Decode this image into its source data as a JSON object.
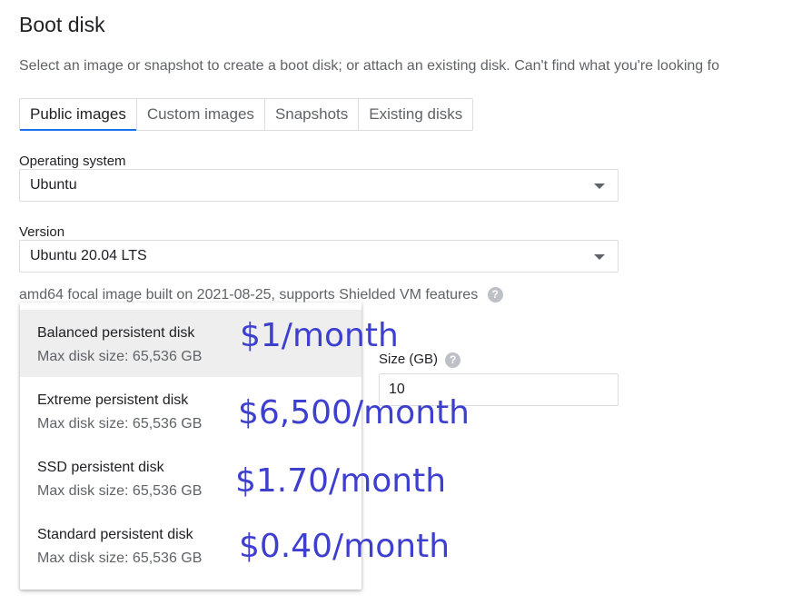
{
  "section": {
    "title": "Boot disk",
    "description": "Select an image or snapshot to create a boot disk; or attach an existing disk. Can't find what you're looking fo"
  },
  "tabs": [
    {
      "label": "Public images",
      "active": true
    },
    {
      "label": "Custom images",
      "active": false
    },
    {
      "label": "Snapshots",
      "active": false
    },
    {
      "label": "Existing disks",
      "active": false
    }
  ],
  "os": {
    "label": "Operating system",
    "value": "Ubuntu"
  },
  "version": {
    "label": "Version",
    "value": "Ubuntu 20.04 LTS",
    "helper": "amd64 focal image built on 2021-08-25, supports Shielded VM features",
    "help_icon": "help-circle-icon"
  },
  "size": {
    "label": "Size (GB)",
    "value": "10",
    "help_icon": "help-circle-icon"
  },
  "disk_type_options": [
    {
      "title": "Balanced persistent disk",
      "subtitle": "Max disk size: 65,536 GB",
      "highlighted": true
    },
    {
      "title": "Extreme persistent disk",
      "subtitle": "Max disk size: 65,536 GB",
      "highlighted": false
    },
    {
      "title": "SSD persistent disk",
      "subtitle": "Max disk size: 65,536 GB",
      "highlighted": false
    },
    {
      "title": "Standard persistent disk",
      "subtitle": "Max disk size: 65,536 GB",
      "highlighted": false
    }
  ],
  "price_annotations": [
    "$1/month",
    "$6,500/month",
    "$1.70/month",
    "$0.40/month"
  ],
  "colors": {
    "accent": "#1a73e8",
    "annotation": "#3d3fcf",
    "highlight": "#eeeeee"
  }
}
